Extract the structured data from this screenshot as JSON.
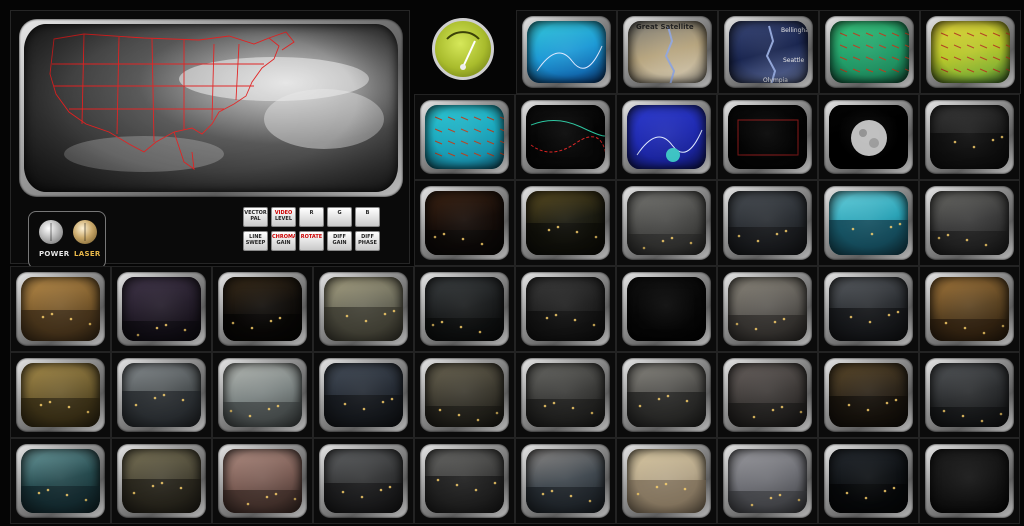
{
  "control_panel": {
    "knob_power_label": "POWER",
    "knob_laser_label": "LASER",
    "buttons": [
      {
        "line1": "VECTOR",
        "line2": "PAL",
        "red": false
      },
      {
        "line1": "VIDEO",
        "line2": "LEVEL",
        "red": true
      },
      {
        "line1": "R",
        "line2": "",
        "red": false
      },
      {
        "line1": "G",
        "line2": "",
        "red": false
      },
      {
        "line1": "B",
        "line2": "",
        "red": false
      },
      {
        "line1": "LINE",
        "line2": "SWEEP",
        "red": false
      },
      {
        "line1": "CHROMA",
        "line2": "GAIN",
        "red": true
      },
      {
        "line1": "ROTATE",
        "line2": "",
        "red": true
      },
      {
        "line1": "DIFF",
        "line2": "GAIN",
        "red": false
      },
      {
        "line1": "DIFF",
        "line2": "PHASE",
        "red": false
      }
    ]
  },
  "map_labels": {
    "bellingham": "Bellingham",
    "seattle": "Seattle",
    "olympia": "Olympia",
    "satellite_caption": "Great Satellite"
  },
  "monitors": [
    {
      "row": 0,
      "col": 0,
      "theme": "radar-map",
      "colors": [
        "#1e9ad6",
        "#35c9d8",
        "#0c4e9b"
      ]
    },
    {
      "row": 0,
      "col": 1,
      "theme": "satellite-map",
      "colors": [
        "#b7a57f",
        "#7b7a75",
        "#d9d0bd"
      ]
    },
    {
      "row": 0,
      "col": 2,
      "theme": "puget-sound-map",
      "colors": [
        "#1a2650",
        "#3c4a7a",
        "#6b7aa8"
      ]
    },
    {
      "row": 0,
      "col": 3,
      "theme": "wind-map-green",
      "colors": [
        "#22a06a",
        "#39c47c",
        "#1c7d55"
      ]
    },
    {
      "row": 0,
      "col": 4,
      "theme": "wind-map-yellow",
      "colors": [
        "#b7c72b",
        "#e0d23b",
        "#62a33a"
      ]
    },
    {
      "row": 1,
      "col": 0,
      "theme": "wind-map-cyan",
      "colors": [
        "#1ba7bd",
        "#2fc9d6",
        "#167c9a"
      ]
    },
    {
      "row": 1,
      "col": 1,
      "theme": "surface-analysis",
      "colors": [
        "#050505",
        "#101010",
        "#0a0a0a"
      ]
    },
    {
      "row": 1,
      "col": 2,
      "theme": "blue-region-map",
      "colors": [
        "#1f2ab0",
        "#2e3ccf",
        "#151d86"
      ]
    },
    {
      "row": 1,
      "col": 3,
      "theme": "dark-outline-map",
      "colors": [
        "#030303",
        "#0b0b0b",
        "#050505"
      ]
    },
    {
      "row": 1,
      "col": 4,
      "theme": "moon",
      "colors": [
        "#000000",
        "#050505",
        "#000000"
      ]
    },
    {
      "row": 1,
      "col": 5,
      "theme": "night-street",
      "colors": [
        "#1c1c1c",
        "#3a3a3a",
        "#0d0d0d"
      ]
    },
    {
      "row": 2,
      "col": 0,
      "theme": "night-harbor",
      "colors": [
        "#160d09",
        "#3d2414",
        "#0a0706"
      ]
    },
    {
      "row": 2,
      "col": 1,
      "theme": "night-building",
      "colors": [
        "#1a1a10",
        "#5d4f23",
        "#0d0c07"
      ]
    },
    {
      "row": 2,
      "col": 2,
      "theme": "gray-building",
      "colors": [
        "#4a4a48",
        "#777773",
        "#2b2b29"
      ]
    },
    {
      "row": 2,
      "col": 3,
      "theme": "dim-room",
      "colors": [
        "#2a2e33",
        "#4a4f55",
        "#151719"
      ]
    },
    {
      "row": 2,
      "col": 4,
      "theme": "tower-cyan",
      "colors": [
        "#2aa2b6",
        "#6cd2de",
        "#123f4d"
      ]
    },
    {
      "row": 2,
      "col": 5,
      "theme": "office-lobby",
      "colors": [
        "#3a3a3a",
        "#6a6a66",
        "#1d1d1d"
      ]
    },
    {
      "row": 3,
      "col": 0,
      "theme": "sunset-harbor",
      "colors": [
        "#7a5a2c",
        "#b98c4a",
        "#3b2a16"
      ]
    },
    {
      "row": 3,
      "col": 1,
      "theme": "dark-pier",
      "colors": [
        "#241d2a",
        "#41364a",
        "#0e0b11"
      ]
    },
    {
      "row": 3,
      "col": 2,
      "theme": "city-lights",
      "colors": [
        "#120f0c",
        "#3a2c1a",
        "#060504"
      ]
    },
    {
      "row": 3,
      "col": 3,
      "theme": "lobby-fountain",
      "colors": [
        "#6b6a5a",
        "#a9a384",
        "#3a382e"
      ]
    },
    {
      "row": 3,
      "col": 4,
      "theme": "night-plaza",
      "colors": [
        "#1b1d1e",
        "#3c4042",
        "#0b0c0c"
      ]
    },
    {
      "row": 3,
      "col": 5,
      "theme": "dark-street",
      "colors": [
        "#202020",
        "#3b3b3b",
        "#0f0f0f"
      ]
    },
    {
      "row": 3,
      "col": 6,
      "theme": "black-screen",
      "colors": [
        "#070707",
        "#111111",
        "#030303"
      ]
    },
    {
      "row": 3,
      "col": 7,
      "theme": "overcast-town",
      "colors": [
        "#5d5a55",
        "#8a857a",
        "#2d2b28"
      ]
    },
    {
      "row": 3,
      "col": 8,
      "theme": "night-offices",
      "colors": [
        "#2b2e32",
        "#5a5e63",
        "#121315"
      ]
    },
    {
      "row": 3,
      "col": 9,
      "theme": "lit-lobby",
      "colors": [
        "#5b4322",
        "#a5783c",
        "#2a1d0e"
      ]
    },
    {
      "row": 4,
      "col": 0,
      "theme": "old-town",
      "colors": [
        "#6b5a2e",
        "#a88d4c",
        "#2f2712"
      ]
    },
    {
      "row": 4,
      "col": 1,
      "theme": "grey-bay",
      "colors": [
        "#4d5254",
        "#8a9093",
        "#23272a"
      ]
    },
    {
      "row": 4,
      "col": 2,
      "theme": "foggy-beach",
      "colors": [
        "#7c8483",
        "#b7bbb6",
        "#3f4443"
      ]
    },
    {
      "row": 4,
      "col": 3,
      "theme": "dusk-campus",
      "colors": [
        "#262c35",
        "#47505c",
        "#111418"
      ]
    },
    {
      "row": 4,
      "col": 4,
      "theme": "courtyard",
      "colors": [
        "#3d3a30",
        "#6c6653",
        "#1b1a15"
      ]
    },
    {
      "row": 4,
      "col": 5,
      "theme": "grey-harbor",
      "colors": [
        "#3b3b39",
        "#6c6c68",
        "#1b1b1a"
      ]
    },
    {
      "row": 4,
      "col": 6,
      "theme": "street-view",
      "colors": [
        "#4e4d4a",
        "#8d8b84",
        "#222220"
      ]
    },
    {
      "row": 4,
      "col": 7,
      "theme": "plaza-steps",
      "colors": [
        "#3e3a38",
        "#6a6360",
        "#1d1b1a"
      ]
    },
    {
      "row": 4,
      "col": 8,
      "theme": "night-mall",
      "colors": [
        "#2d251a",
        "#5e4b2c",
        "#120e09"
      ]
    },
    {
      "row": 4,
      "col": 9,
      "theme": "night-parking",
      "colors": [
        "#2b2d2f",
        "#55585b",
        "#121314"
      ]
    },
    {
      "row": 5,
      "col": 0,
      "theme": "snowy-bridge",
      "colors": [
        "#25494d",
        "#6e9ea1",
        "#12262a"
      ]
    },
    {
      "row": 5,
      "col": 1,
      "theme": "small-plaza",
      "colors": [
        "#4a4636",
        "#7b7458",
        "#201e17"
      ]
    },
    {
      "row": 5,
      "col": 2,
      "theme": "red-roofs",
      "colors": [
        "#7a5c54",
        "#b18e83",
        "#3b2a26"
      ]
    },
    {
      "row": 5,
      "col": 3,
      "theme": "parking-lot",
      "colors": [
        "#343536",
        "#626466",
        "#161718"
      ]
    },
    {
      "row": 5,
      "col": 4,
      "theme": "empty-road",
      "colors": [
        "#3d3d3c",
        "#6a6a68",
        "#1a1a1a"
      ]
    },
    {
      "row": 5,
      "col": 5,
      "theme": "dawn-harbor",
      "colors": [
        "#40484f",
        "#8f8c8a",
        "#1c2126"
      ]
    },
    {
      "row": 5,
      "col": 6,
      "theme": "sunny-beach",
      "colors": [
        "#b5a68a",
        "#d8c7a1",
        "#7d6e59"
      ]
    },
    {
      "row": 5,
      "col": 7,
      "theme": "hazy-grey",
      "colors": [
        "#6d6e74",
        "#9c9ca1",
        "#3d3e42"
      ]
    },
    {
      "row": 5,
      "col": 8,
      "theme": "night-shore",
      "colors": [
        "#0e1114",
        "#262b31",
        "#050607"
      ]
    },
    {
      "row": 5,
      "col": 9,
      "theme": "black-screen",
      "colors": [
        "#151515",
        "#1f1f1f",
        "#0a0a0a"
      ]
    }
  ]
}
